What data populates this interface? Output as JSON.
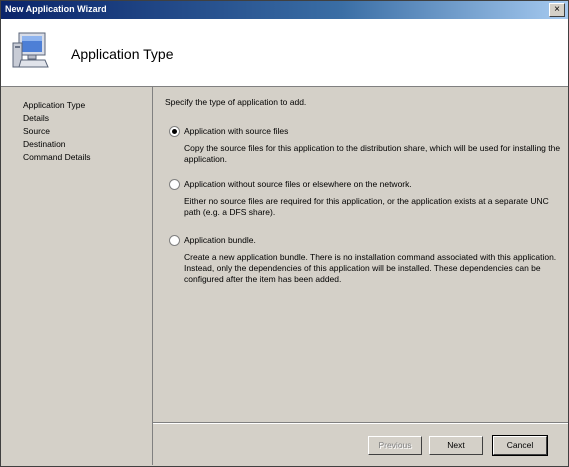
{
  "window": {
    "title": "New Application Wizard",
    "close_symbol": "×"
  },
  "header": {
    "title": "Application Type",
    "icon": "computer-icon"
  },
  "nav": {
    "items": [
      "Application Type",
      "Details",
      "Source",
      "Destination",
      "Command Details"
    ]
  },
  "content": {
    "instruction": "Specify the type of application to add.",
    "options": [
      {
        "label": "Application with source files",
        "selected": true,
        "description": "Copy the source files for this application to the distribution share, which will be used for installing the application."
      },
      {
        "label": "Application without source files or elsewhere on the network.",
        "selected": false,
        "description": "Either no source files are required for this application, or the application exists at a separate UNC path (e.g. a DFS share)."
      },
      {
        "label": "Application bundle.",
        "selected": false,
        "description": "Create a new application bundle.  There is no installation command associated with this application.  Instead, only the dependencies of this application will be installed.  These dependencies can be configured after the item has been added."
      }
    ]
  },
  "buttons": {
    "previous": "Previous",
    "next": "Next",
    "cancel": "Cancel"
  }
}
